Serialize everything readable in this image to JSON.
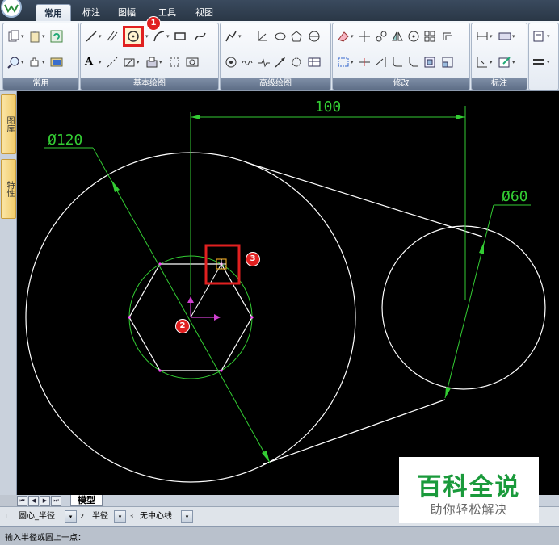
{
  "menu": {
    "tabs": [
      "常用",
      "标注",
      "图幅",
      "工具",
      "视图"
    ],
    "active_tab": "常用"
  },
  "ribbon": {
    "groups": [
      "常用",
      "基本绘图",
      "高级绘图",
      "修改",
      "标注"
    ]
  },
  "left_panel": {
    "tabs": [
      "图库",
      "特性"
    ]
  },
  "drawing": {
    "dim_distance": "100",
    "dim_large": "Ø120",
    "dim_small": "Ø60",
    "colors": {
      "background": "#000000",
      "geometry": "#ffffff",
      "dimension": "#33cc33",
      "marker": "#e02020"
    }
  },
  "callouts": [
    "1",
    "2",
    "3"
  ],
  "layout_tabs": {
    "model": "模型"
  },
  "command_options": [
    {
      "index": "1.",
      "label": "圆心_半径"
    },
    {
      "index": "2.",
      "label": "半径"
    },
    {
      "index": "3.",
      "label": "无中心线"
    }
  ],
  "command_prompt": "输入半径或圆上一点：",
  "watermark": {
    "title": "百科全说",
    "subtitle": "助你轻松解决"
  }
}
